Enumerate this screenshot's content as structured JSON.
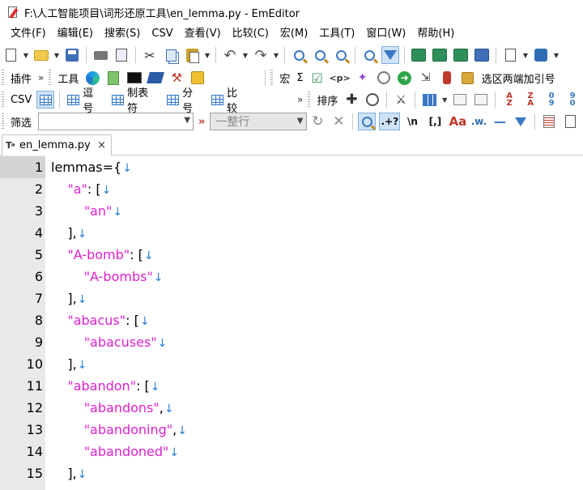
{
  "window": {
    "title": "F:\\人工智能项目\\词形还原工具\\en_lemma.py - EmEditor"
  },
  "menu": [
    "文件(F)",
    "编辑(E)",
    "搜索(S)",
    "CSV",
    "查看(V)",
    "比较(C)",
    "宏(M)",
    "工具(T)",
    "窗口(W)",
    "帮助(H)"
  ],
  "toolbar2": {
    "plugins_label": "插件",
    "tools_label": "工具",
    "macro_label": "宏",
    "sigma_label": "Σ",
    "tag_label": "<p>",
    "quote_label": "选区两端加引号"
  },
  "toolbar3": {
    "csv_label": "CSV",
    "comma_label": "逗号",
    "tab_label": "制表符",
    "semicolon_label": "分号",
    "compare_label": "比较",
    "sort_label": "排序"
  },
  "filterbar": {
    "label": "筛选",
    "input_value": "",
    "mode_value": "一整行",
    "regex_label": ".+?",
    "escape_label": "\\n",
    "bracket_label": "[,]"
  },
  "tab": {
    "file_name": "en_lemma.py",
    "close_glyph": "×"
  },
  "editor": {
    "eol_glyph": "↓",
    "current_line": 1,
    "lines": [
      {
        "no": "1",
        "indent": "",
        "parts": [
          {
            "t": "lemmas={",
            "c": "plain"
          }
        ]
      },
      {
        "no": "2",
        "indent": "    ",
        "parts": [
          {
            "t": "\"a\"",
            "c": "str"
          },
          {
            "t": ": [",
            "c": "plain"
          }
        ]
      },
      {
        "no": "3",
        "indent": "        ",
        "parts": [
          {
            "t": "\"an\"",
            "c": "str"
          }
        ]
      },
      {
        "no": "4",
        "indent": "    ",
        "parts": [
          {
            "t": "],",
            "c": "plain"
          }
        ]
      },
      {
        "no": "5",
        "indent": "    ",
        "parts": [
          {
            "t": "\"A-bomb\"",
            "c": "str"
          },
          {
            "t": ": [",
            "c": "plain"
          }
        ]
      },
      {
        "no": "6",
        "indent": "        ",
        "parts": [
          {
            "t": "\"A-bombs\"",
            "c": "str"
          }
        ]
      },
      {
        "no": "7",
        "indent": "    ",
        "parts": [
          {
            "t": "],",
            "c": "plain"
          }
        ]
      },
      {
        "no": "8",
        "indent": "    ",
        "parts": [
          {
            "t": "\"abacus\"",
            "c": "str"
          },
          {
            "t": ": [",
            "c": "plain"
          }
        ]
      },
      {
        "no": "9",
        "indent": "        ",
        "parts": [
          {
            "t": "\"abacuses\"",
            "c": "str"
          }
        ]
      },
      {
        "no": "10",
        "indent": "    ",
        "parts": [
          {
            "t": "],",
            "c": "plain"
          }
        ]
      },
      {
        "no": "11",
        "indent": "    ",
        "parts": [
          {
            "t": "\"abandon\"",
            "c": "str"
          },
          {
            "t": ": [",
            "c": "plain"
          }
        ]
      },
      {
        "no": "12",
        "indent": "        ",
        "parts": [
          {
            "t": "\"abandons\"",
            "c": "str"
          },
          {
            "t": ",",
            "c": "plain"
          }
        ]
      },
      {
        "no": "13",
        "indent": "        ",
        "parts": [
          {
            "t": "\"abandoning\"",
            "c": "str"
          },
          {
            "t": ",",
            "c": "plain"
          }
        ]
      },
      {
        "no": "14",
        "indent": "        ",
        "parts": [
          {
            "t": "\"abandoned\"",
            "c": "str"
          }
        ]
      },
      {
        "no": "15",
        "indent": "    ",
        "parts": [
          {
            "t": "],",
            "c": "plain"
          }
        ]
      }
    ]
  },
  "colors": {
    "string": "#e020d0",
    "eol_marker": "#2a7fd4",
    "gutter": "#e9e9e9",
    "current_line_number": "#d4d4d4"
  }
}
